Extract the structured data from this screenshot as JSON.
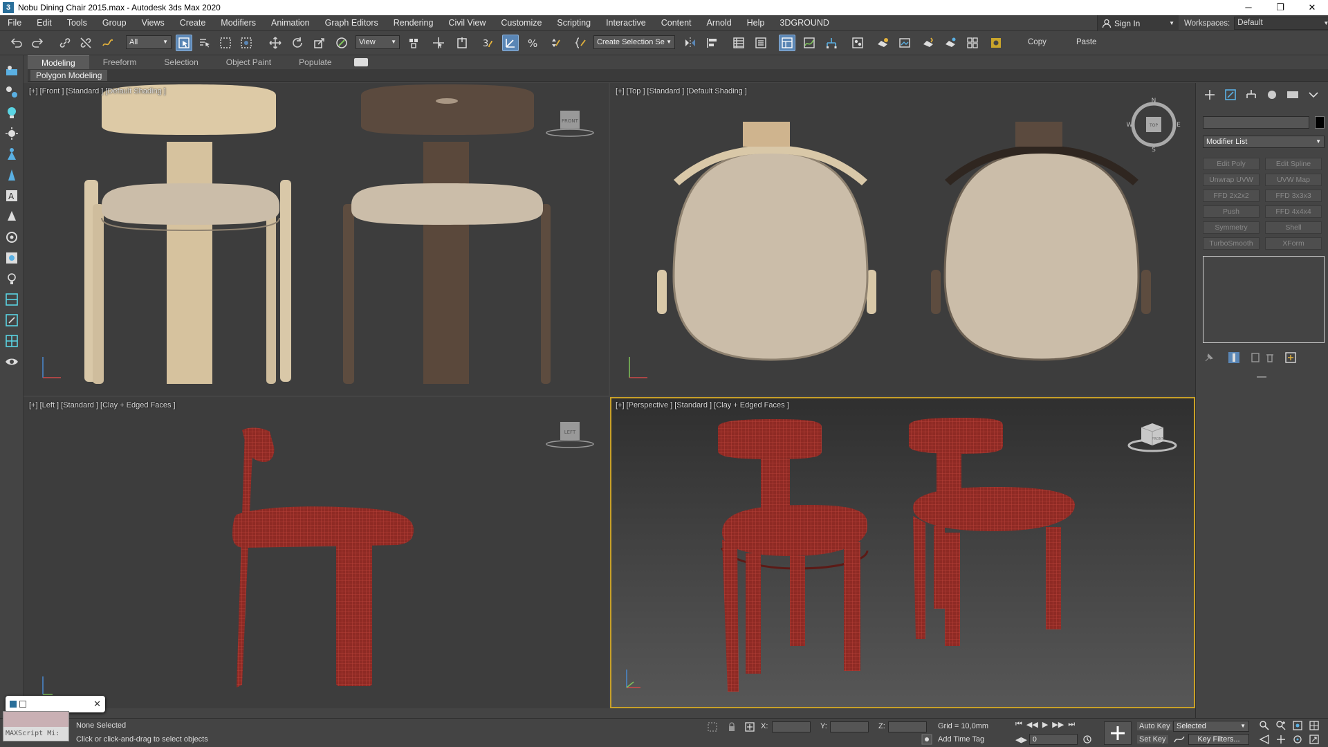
{
  "window": {
    "title": "Nobu Dining Chair 2015.max - Autodesk 3ds Max 2020",
    "app_icon": "3",
    "minimize": "─",
    "maximize": "❐",
    "close": "✕"
  },
  "menubar": {
    "items": [
      "File",
      "Edit",
      "Tools",
      "Group",
      "Views",
      "Create",
      "Modifiers",
      "Animation",
      "Graph Editors",
      "Rendering",
      "Civil View",
      "Customize",
      "Scripting",
      "Interactive",
      "Content",
      "Arnold",
      "Help",
      "3DGROUND"
    ],
    "sign_in": "Sign In",
    "workspaces_label": "Workspaces:",
    "workspace_value": "Default"
  },
  "toolbar": {
    "selection_filter": "All",
    "ref_coord": "View",
    "named_selection": "Create Selection Se",
    "copy_label": "Copy",
    "paste_label": "Paste"
  },
  "ribbon": {
    "tabs": [
      "Modeling",
      "Freeform",
      "Selection",
      "Object Paint",
      "Populate"
    ],
    "active_tab": "Modeling",
    "panel_label": "Polygon Modeling"
  },
  "viewports": {
    "front": {
      "label": "[+] [Front ] [Standard ] [Default Shading ]",
      "cube": "FRONT"
    },
    "top": {
      "label": "[+] [Top ] [Standard ] [Default Shading ]",
      "cube": "TOP",
      "compass": {
        "n": "N",
        "s": "S",
        "e": "E",
        "w": "W"
      }
    },
    "left": {
      "label": "[+] [Left ] [Standard ] [Clay + Edged Faces ]",
      "cube": "LEFT"
    },
    "perspective": {
      "label": "[+] [Perspective ] [Standard ] [Clay + Edged Faces ]",
      "cube": "FRONT"
    }
  },
  "command_panel": {
    "modifier_list": "Modifier List",
    "modifier_buttons": [
      "Edit Poly",
      "Edit Spline",
      "Unwrap UVW",
      "UVW Map",
      "FFD 2x2x2",
      "FFD 3x3x3",
      "Push",
      "FFD 4x4x4",
      "Symmetry",
      "Shell",
      "TurboSmooth",
      "XForm"
    ]
  },
  "status": {
    "maxscript_label": "MAXScript Mi:",
    "selection_status": "None Selected",
    "prompt": "Click or click-and-drag to select objects",
    "x_label": "X:",
    "y_label": "Y:",
    "z_label": "Z:",
    "grid": "Grid = 10,0mm",
    "add_time_tag": "Add Time Tag",
    "auto_key": "Auto Key",
    "set_key": "Set Key",
    "key_mode": "Selected",
    "key_filters": "Key Filters...",
    "frame": "0"
  },
  "colors": {
    "wood_light": "#d9c8a8",
    "wood_dark": "#5d4c3f",
    "cushion": "#cbbda9",
    "wire_red": "#8e2a24",
    "active_viewport": "#c8a028",
    "toolbar_active": "#5a86b5"
  }
}
